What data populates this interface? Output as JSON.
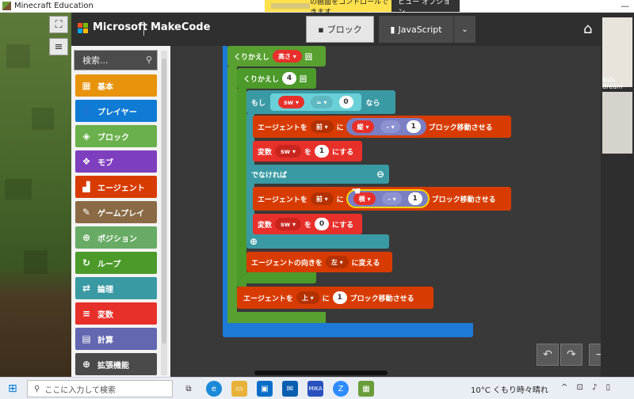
{
  "window": {
    "title": "Minecraft Education",
    "controls": "—"
  },
  "notice": {
    "text": "の画面をコントロールできます",
    "view_options": "ビュー オプション ⌄"
  },
  "side_tools": {
    "expand": "⛶",
    "menu": "≡"
  },
  "header": {
    "brand": "Microsoft",
    "product": "MakeCode",
    "tab_blocks": "ブロック",
    "tab_js": "JavaScript",
    "more": "⌄",
    "home": "⌂"
  },
  "toolbox": {
    "search_placeholder": "検索...",
    "categories": [
      {
        "label": "基本",
        "icon": "▦",
        "color": "#e8930c"
      },
      {
        "label": "プレイヤー",
        "icon": "👤",
        "color": "#0f7bd4"
      },
      {
        "label": "ブロック",
        "icon": "◈",
        "color": "#6ab04c"
      },
      {
        "label": "モブ",
        "icon": "❖",
        "color": "#7e3fbf"
      },
      {
        "label": "エージェント",
        "icon": "▟",
        "color": "#d83b01"
      },
      {
        "label": "ゲームプレイ",
        "icon": "✎",
        "color": "#8a6a45"
      },
      {
        "label": "ポジション",
        "icon": "⊕",
        "color": "#67ab64"
      },
      {
        "label": "ループ",
        "icon": "↻",
        "color": "#4c9a2a"
      },
      {
        "label": "論理",
        "icon": "⇄",
        "color": "#3a9aa3"
      },
      {
        "label": "変数",
        "icon": "≡",
        "color": "#e8302b"
      },
      {
        "label": "計算",
        "icon": "▤",
        "color": "#6367b0"
      },
      {
        "label": "拡張機能",
        "icon": "⊕",
        "color": "#4a4a4a"
      }
    ]
  },
  "blocks": {
    "repeat_outer": {
      "label": "くりかえし",
      "var": "高さ",
      "suffix": "回"
    },
    "repeat_inner": {
      "label": "くりかえし",
      "count": "4",
      "suffix": "回"
    },
    "if": {
      "label": "もし",
      "var": "sw",
      "op": "=",
      "value": "0",
      "then": "なら"
    },
    "move1": {
      "label": "エージェントを",
      "dir": "前",
      "ni": "に",
      "var": "縦",
      "op": "-",
      "value": "1",
      "suffix": "ブロック移動させる"
    },
    "set1": {
      "label": "変数",
      "var": "sw",
      "wo": "を",
      "value": "1",
      "suffix": "にする"
    },
    "else": {
      "label": "でなければ",
      "minus": "⊖"
    },
    "move2": {
      "label": "エージェントを",
      "dir": "前",
      "ni": "に",
      "var": "横",
      "op": "-",
      "value": "1",
      "suffix": "ブロック移動させる"
    },
    "set2": {
      "label": "変数",
      "var": "sw",
      "wo": "を",
      "value": "0",
      "suffix": "にする"
    },
    "plus": "⊕",
    "turn": {
      "label": "エージェントの向きを",
      "dir": "左",
      "suffix": "に変える"
    },
    "move_up": {
      "label": "エージェントを",
      "dir": "上",
      "ni": "に",
      "value": "1",
      "suffix": "ブロック移動させる"
    }
  },
  "zoom": {
    "undo": "↶",
    "redo": "↷",
    "zoom_out": "−",
    "zoom_in": "+"
  },
  "participant": {
    "name": "kids dream"
  },
  "taskbar": {
    "search_placeholder": "ここに入力して検索",
    "mika": "MIKA",
    "weather": "10°C くもり時々晴れ",
    "tray": "^ ⊡ ♪ ▯"
  }
}
